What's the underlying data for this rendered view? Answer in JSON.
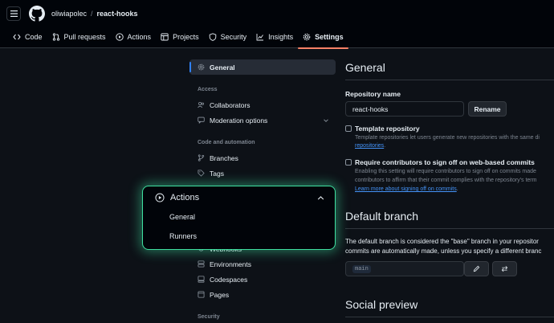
{
  "header": {
    "owner": "oliwiapolec",
    "separator": "/",
    "repo": "react-hooks"
  },
  "tabs": [
    {
      "label": "Code",
      "icon": "code-icon"
    },
    {
      "label": "Pull requests",
      "icon": "pull-request-icon"
    },
    {
      "label": "Actions",
      "icon": "play-icon"
    },
    {
      "label": "Projects",
      "icon": "table-icon"
    },
    {
      "label": "Security",
      "icon": "shield-icon"
    },
    {
      "label": "Insights",
      "icon": "graph-icon"
    },
    {
      "label": "Settings",
      "icon": "gear-icon",
      "selected": true
    }
  ],
  "sidenav": {
    "general": "General",
    "access_heading": "Access",
    "collaborators": "Collaborators",
    "moderation": "Moderation options",
    "code_heading": "Code and automation",
    "branches": "Branches",
    "tags": "Tags",
    "webhooks": "Webhooks",
    "environments": "Environments",
    "codespaces": "Codespaces",
    "pages": "Pages",
    "security_heading": "Security"
  },
  "popover": {
    "title": "Actions",
    "items": [
      "General",
      "Runners"
    ]
  },
  "main": {
    "title": "General",
    "repo_name_label": "Repository name",
    "repo_name_value": "react-hooks",
    "rename_button": "Rename",
    "template_title": "Template repository",
    "template_desc": "Template repositories let users generate new repositories with the same di",
    "template_link": "repositories",
    "signoff_title": "Require contributors to sign off on web-based commits",
    "signoff_desc1": "Enabling this setting will require contributors to sign off on commits made",
    "signoff_desc2": "contributors to affirm that their commit complies with the repository's term",
    "signoff_link": "Learn more about signing off on commits",
    "default_branch_title": "Default branch",
    "default_branch_desc1": "The default branch is considered the \"base\" branch in your repositor",
    "default_branch_desc2": "commits are automatically made, unless you specify a different branc",
    "branch_value": "main",
    "social_preview_title": "Social preview"
  },
  "colors": {
    "accent_underline": "#f78166",
    "popover_glow": "#3fe0a0",
    "link": "#4493f8"
  }
}
